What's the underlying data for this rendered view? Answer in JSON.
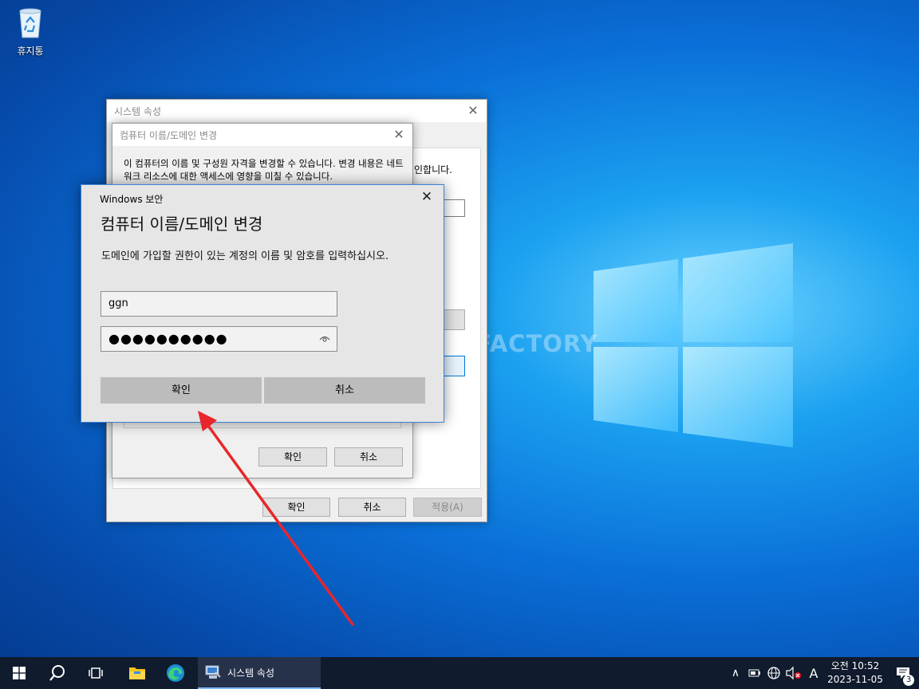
{
  "desktop": {
    "recycle_bin_label": "휴지통",
    "watermark": "MANUAL FACTORY"
  },
  "system_properties": {
    "title": "시스템 속성",
    "partial_text": "인합니다.",
    "ok_label": "확인",
    "cancel_label": "취소",
    "apply_label": "적용(A)"
  },
  "computer_name_dialog": {
    "title": "컴퓨터 이름/도메인 변경",
    "description": "이 컴퓨터의 이름 및 구성원 자격을 변경할 수 있습니다. 변경 내용은 네트워크 리소스에 대한 액세스에 영향을 미칠 수 있습니다.",
    "ok_label": "확인",
    "cancel_label": "취소"
  },
  "security_dialog": {
    "window_title": "Windows 보안",
    "heading": "컴퓨터 이름/도메인 변경",
    "prompt": "도메인에 가입할 권한이 있는 계정의 이름 및 암호를 입력하십시오.",
    "username_value": "ggn",
    "password_value": "●●●●●●●●●●",
    "ok_label": "확인",
    "cancel_label": "취소"
  },
  "taskbar": {
    "active_task_label": "시스템 속성",
    "ime_indicator": "A",
    "clock_time": "오전 10:52",
    "clock_date": "2023-11-05",
    "notification_count": "3"
  },
  "colors": {
    "accent": "#0078d7",
    "arrow": "#e8262b",
    "taskbar": "#101b2d"
  }
}
